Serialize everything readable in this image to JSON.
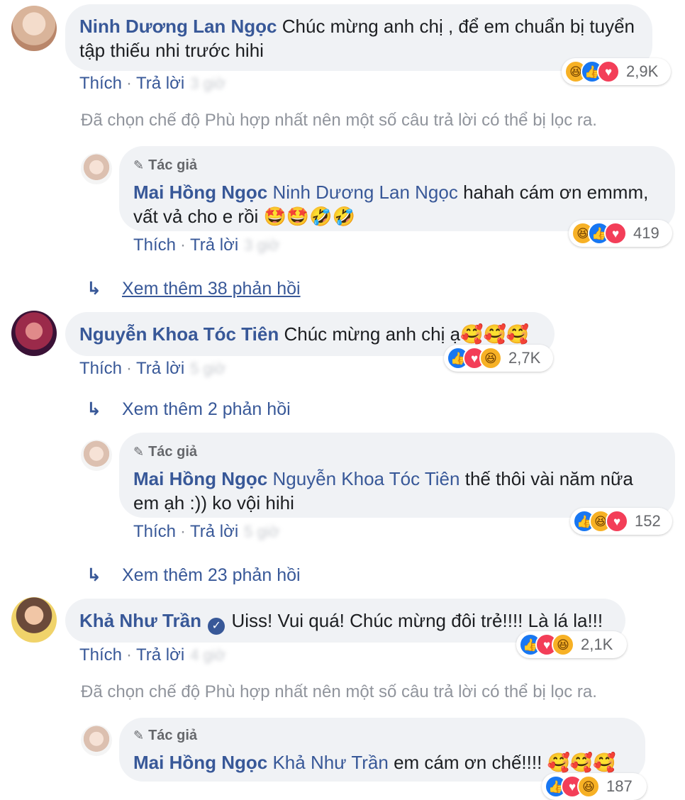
{
  "comments": {
    "c1": {
      "author": "Ninh Dương Lan Ngọc",
      "text": "Chúc mừng anh chị , để em chuẩn bị tuyển tập thiếu nhi trước hihi",
      "like": "Thích",
      "reply": "Trả lời",
      "time": "3 giờ",
      "reaction_count": "2,9K"
    },
    "n1": "Đã chọn chế độ Phù hợp nhất nên một số câu trả lời có thể bị lọc ra.",
    "r1": {
      "author_badge": "Tác giả",
      "author": "Mai Hồng Ngọc",
      "mention": "Ninh Dương Lan Ngọc",
      "text": "hahah cám ơn emmm, vất vả cho e rồi",
      "emojis": "🤩🤩🤣🤣",
      "like": "Thích",
      "reply": "Trả lời",
      "time": "3 giờ",
      "reaction_count": "419"
    },
    "m1": "Xem thêm 38 phản hồi",
    "c2": {
      "author": "Nguyễn Khoa Tóc Tiên",
      "text": "Chúc mừng anh chị ạ",
      "emojis": "🥰🥰🥰",
      "like": "Thích",
      "reply": "Trả lời",
      "time": "5 giờ",
      "reaction_count": "2,7K"
    },
    "m2": "Xem thêm 2 phản hồi",
    "r2": {
      "author_badge": "Tác giả",
      "author": "Mai Hồng Ngọc",
      "mention": "Nguyễn Khoa Tóc Tiên",
      "text": "thế thôi vài năm nữa em ạh :)) ko vội hihi",
      "like": "Thích",
      "reply": "Trả lời",
      "time": "5 giờ",
      "reaction_count": "152"
    },
    "m3": "Xem thêm 23 phản hồi",
    "c3": {
      "author": "Khả Như Trần",
      "text": "Uiss! Vui quá! Chúc mừng đôi trẻ!!!! Là lá la!!!",
      "like": "Thích",
      "reply": "Trả lời",
      "time": "4 giờ",
      "reaction_count": "2,1K"
    },
    "n2": "Đã chọn chế độ Phù hợp nhất nên một số câu trả lời có thể bị lọc ra.",
    "r3": {
      "author_badge": "Tác giả",
      "author": "Mai Hồng Ngọc",
      "mention": "Khả Như Trần",
      "text": "em cám ơn chế!!!!",
      "emojis": "🥰🥰🥰",
      "reaction_count": "187"
    }
  },
  "icons": {
    "like": "like-icon",
    "love": "love-icon",
    "haha": "haha-icon",
    "verified": "verified-badge-icon",
    "reply_arrow": "reply-arrow-icon",
    "pen": "pen-icon"
  },
  "colors": {
    "link": "#385898",
    "bubble": "#f0f2f5",
    "muted": "#90949c",
    "like": "#1877f2",
    "love": "#f33e58",
    "haha": "#f7b125"
  }
}
